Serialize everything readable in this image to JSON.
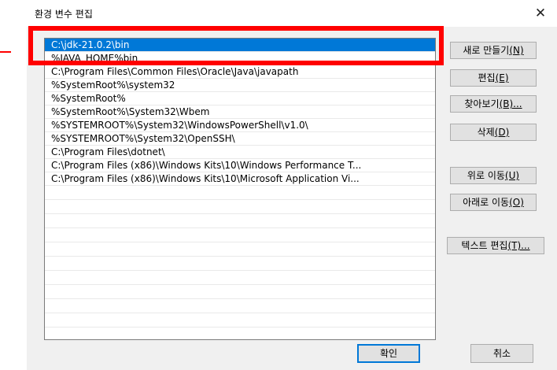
{
  "dialog": {
    "title": "환경 변수 편집",
    "close_glyph": "✕"
  },
  "list": {
    "items": [
      "C:\\jdk-21.0.2\\bin",
      "%JAVA_HOME%bin",
      "C:\\Program Files\\Common Files\\Oracle\\Java\\javapath",
      "%SystemRoot%\\system32",
      "%SystemRoot%",
      "%SystemRoot%\\System32\\Wbem",
      "%SYSTEMROOT%\\System32\\WindowsPowerShell\\v1.0\\",
      "%SYSTEMROOT%\\System32\\OpenSSH\\",
      "C:\\Program Files\\dotnet\\",
      "C:\\Program Files (x86)\\Windows Kits\\10\\Windows Performance T...",
      "C:\\Program Files (x86)\\Windows Kits\\10\\Microsoft Application Vi..."
    ],
    "selected_index": 0
  },
  "buttons": {
    "new": {
      "label": "새로 만들기",
      "mnemonic": "(N)"
    },
    "edit": {
      "label": "편집",
      "mnemonic": "(E)"
    },
    "browse": {
      "label": "찾아보기",
      "mnemonic": "(B)..."
    },
    "delete": {
      "label": "삭제",
      "mnemonic": "(D)"
    },
    "move_up": {
      "label": "위로 이동",
      "mnemonic": "(U)"
    },
    "move_down": {
      "label": "아래로 이동",
      "mnemonic": "(O)"
    },
    "edit_text": {
      "label": "텍스트 편집",
      "mnemonic": "(T)..."
    },
    "ok": "확인",
    "cancel": "취소"
  },
  "colors": {
    "selection": "#0078d7",
    "annotation": "#ff0000"
  }
}
